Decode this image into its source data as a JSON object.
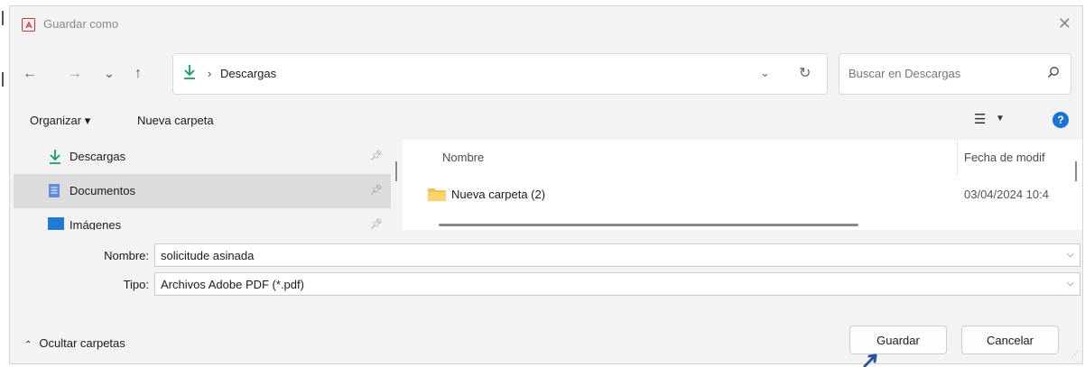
{
  "window": {
    "title": "Guardar como"
  },
  "nav": {
    "back": "←",
    "forward": "→",
    "recent": "⌄",
    "up": "↑",
    "breadcrumb_sep": "›",
    "location": "Descargas",
    "search_placeholder": "Buscar en Descargas"
  },
  "toolbar": {
    "organize": "Organizar ▾",
    "new_folder": "Nueva carpeta"
  },
  "sidebar": {
    "items": [
      {
        "label": "Descargas"
      },
      {
        "label": "Documentos"
      },
      {
        "label": "Imágenes"
      }
    ]
  },
  "files": {
    "columns": {
      "name": "Nombre",
      "date": "Fecha de modif"
    },
    "rows": [
      {
        "name": "Nueva carpeta (2)",
        "date": "03/04/2024 10:4"
      }
    ]
  },
  "form": {
    "name_label": "Nombre:",
    "name_value": "solicitude asinada",
    "type_label": "Tipo:",
    "type_value": "Archivos Adobe PDF (*.pdf)"
  },
  "footer": {
    "hide_folders": "Ocultar carpetas",
    "save": "Guardar",
    "cancel": "Cancelar"
  },
  "colors": {
    "accent": "#1a73d9",
    "folder": "#f2c14e",
    "download_arrow": "#1a9c5b",
    "pdf_icon": "#d0312d"
  },
  "icons": [
    "pdf-app-icon",
    "close-icon",
    "back-icon",
    "forward-icon",
    "recent-icon",
    "up-icon",
    "download-icon",
    "refresh-icon",
    "search-icon",
    "view-icon",
    "help-icon",
    "pin-icon",
    "documents-icon",
    "images-icon",
    "folder-icon",
    "chevron-up-icon"
  ]
}
